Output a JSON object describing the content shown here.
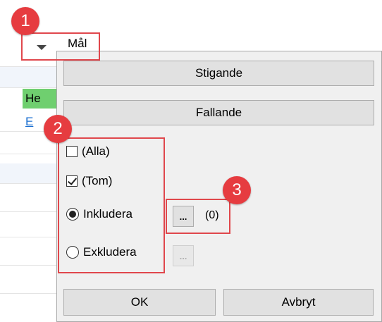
{
  "grid": {
    "cell_he": "He",
    "cell_e": "E"
  },
  "header": {
    "label": "Mål"
  },
  "sort": {
    "ascending": "Stigande",
    "descending": "Fallande"
  },
  "filter": {
    "all_label": "(Alla)",
    "all_checked": false,
    "empty_label": "(Tom)",
    "empty_checked": true,
    "include_label": "Inkludera",
    "include_selected": true,
    "exclude_label": "Exkludera",
    "exclude_selected": false,
    "dots_label": "...",
    "count": "(0)"
  },
  "actions": {
    "ok": "OK",
    "cancel": "Avbryt"
  },
  "annotations": {
    "m1": "1",
    "m2": "2",
    "m3": "3"
  },
  "colors": {
    "annotation": "#e63c40",
    "panel_bg": "#f0f0f0",
    "highlight_cell": "#6fcf6f"
  }
}
